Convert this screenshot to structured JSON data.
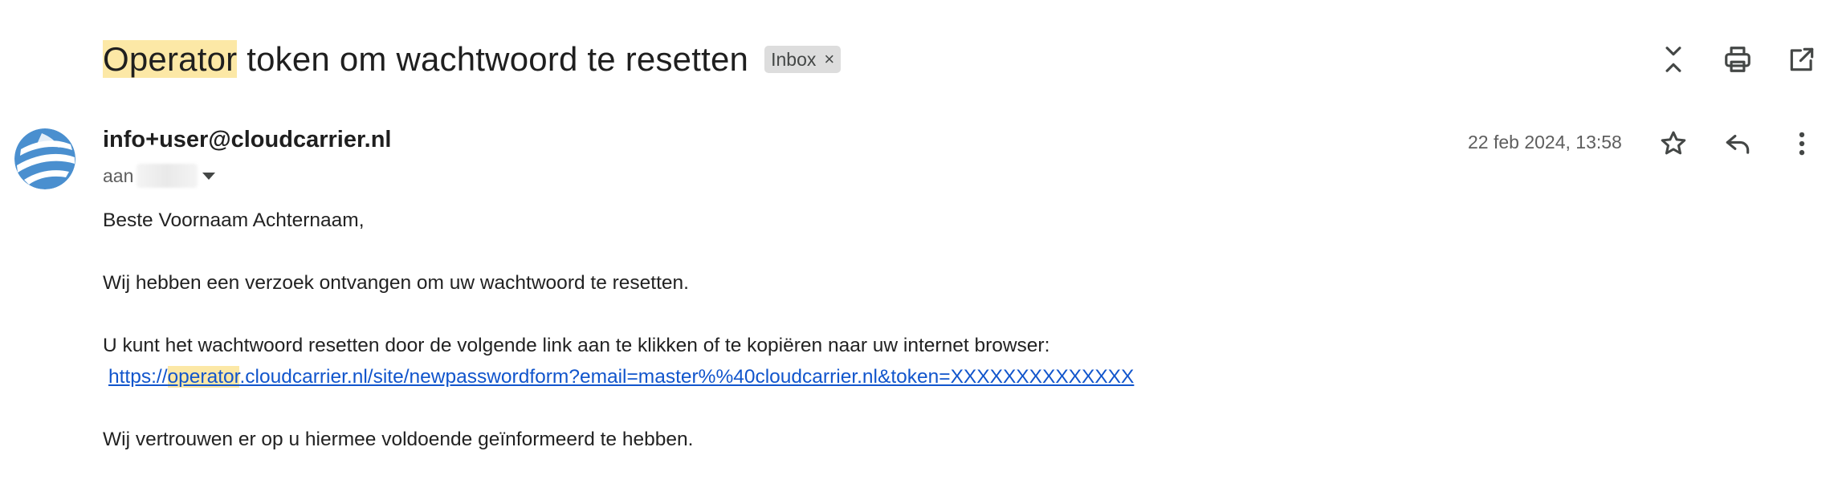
{
  "header": {
    "subject_highlight": "Operator",
    "subject_rest": " token om wachtwoord te resetten",
    "label": "Inbox",
    "label_remove": "×"
  },
  "toolbar_icons": [
    "collapse-icon",
    "print-icon",
    "open-in-new-window-icon"
  ],
  "message": {
    "sender": "info+user@cloudcarrier.nl",
    "to_prefix": "aan",
    "date": "22 feb 2024, 13:58",
    "action_icons": [
      "star-icon",
      "reply-icon",
      "more-vert-icon"
    ]
  },
  "body": {
    "greeting": "Beste Voornaam Achternaam,",
    "line1": "Wij hebben een verzoek ontvangen om uw wachtwoord te resetten.",
    "line2": "U kunt het wachtwoord resetten door de volgende link aan te klikken of te kopiëren naar uw internet browser:",
    "link_prefix": "https://",
    "link_highlight": "operator",
    "link_suffix": ".cloudcarrier.nl/site/newpasswordform?email=master%%40cloudcarrier.nl&token=XXXXXXXXXXXXXX",
    "closing": "Wij vertrouwen er op u hiermee voldoende geïnformeerd te hebben."
  },
  "colors": {
    "highlight": "#fce8a6",
    "link": "#1155cc",
    "label_bg": "#dddddd",
    "avatar_blue": "#4a8fcf"
  }
}
